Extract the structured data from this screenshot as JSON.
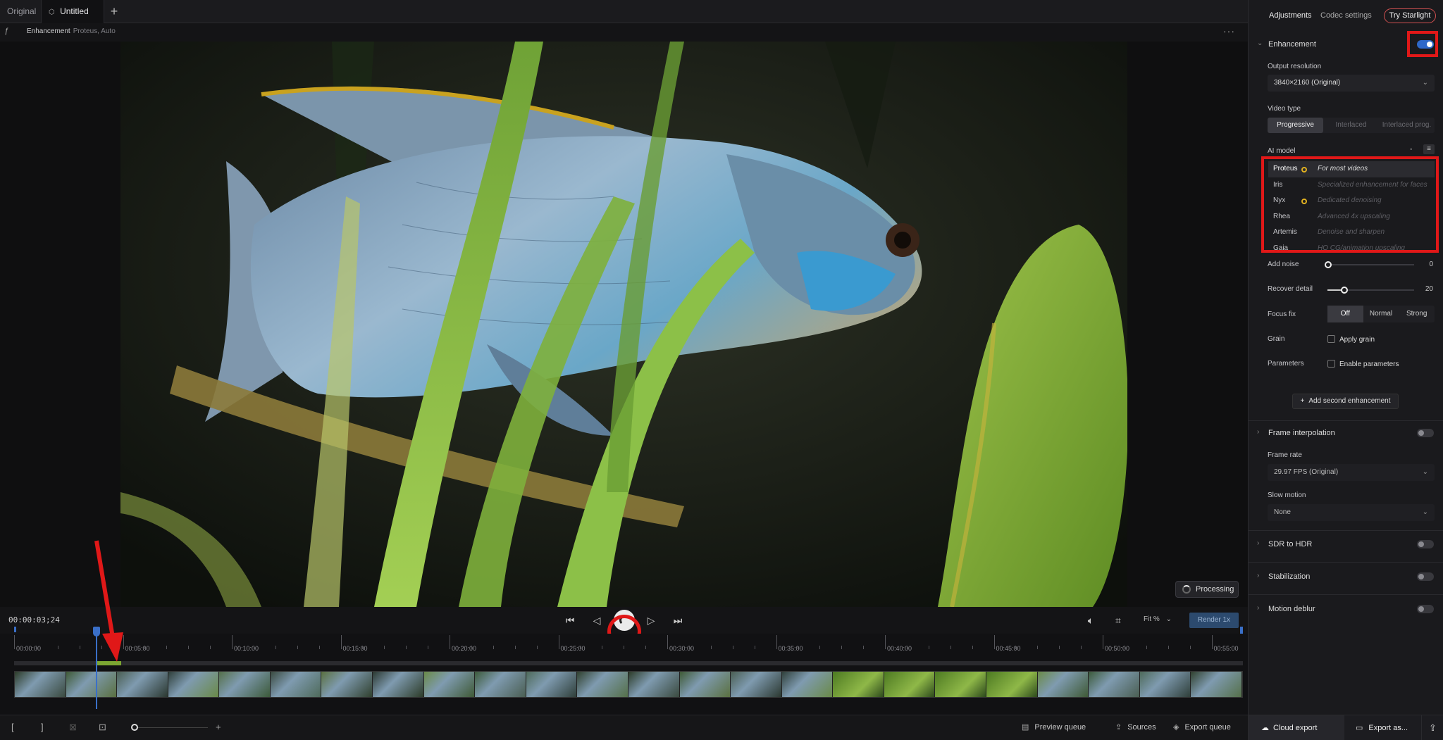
{
  "tabs": [
    {
      "label": "Original"
    },
    {
      "label": "Untitled"
    }
  ],
  "subbar": {
    "title": "Enhancement",
    "subtitle": "Proteus, Auto"
  },
  "viewer": {
    "processing_label": "Processing"
  },
  "transport": {
    "timecode": "00:00:03;24",
    "fit_label": "Fit %",
    "render_label": "Render 1x"
  },
  "timeline": {
    "ticks": [
      "00:00:00",
      "00:05:00",
      "00:10:00",
      "00:15:00",
      "00:20:00",
      "00:25:00",
      "00:30:00",
      "00:35:00",
      "00:40:00",
      "00:45:00",
      "00:50:00",
      "00:55:00"
    ]
  },
  "bottombar": {
    "preview_queue": "Preview queue",
    "sources": "Sources",
    "export_queue": "Export queue"
  },
  "panel": {
    "tabs": {
      "adjustments": "Adjustments",
      "codec": "Codec settings",
      "starlight": "Try Starlight"
    },
    "enhancement": {
      "title": "Enhancement",
      "output_resolution_label": "Output resolution",
      "output_resolution_value": "3840×2160 (Original)",
      "video_type_label": "Video type",
      "video_types": [
        "Progressive",
        "Interlaced",
        "Interlaced prog."
      ],
      "ai_model_label": "AI model",
      "models": [
        {
          "name": "Proteus",
          "desc": "For most videos"
        },
        {
          "name": "Iris",
          "desc": "Specialized enhancement for faces"
        },
        {
          "name": "Nyx",
          "desc": "Dedicated denoising"
        },
        {
          "name": "Rhea",
          "desc": "Advanced 4x upscaling"
        },
        {
          "name": "Artemis",
          "desc": "Denoise and sharpen"
        },
        {
          "name": "Gaia",
          "desc": "HQ CG/animation upscaling"
        }
      ],
      "add_noise_label": "Add noise",
      "add_noise_value": "0",
      "recover_detail_label": "Recover detail",
      "recover_detail_value": "20",
      "focus_fix_label": "Focus fix",
      "focus_fix_options": [
        "Off",
        "Normal",
        "Strong"
      ],
      "grain_label": "Grain",
      "apply_grain": "Apply grain",
      "parameters_label": "Parameters",
      "enable_parameters": "Enable parameters",
      "add_second": "Add second enhancement"
    },
    "frame_interpolation": {
      "title": "Frame interpolation",
      "frame_rate_label": "Frame rate",
      "frame_rate_value": "29.97 FPS (Original)",
      "slow_motion_label": "Slow motion",
      "slow_motion_value": "None"
    },
    "sdr_to_hdr": "SDR to HDR",
    "stabilization": "Stabilization",
    "motion_deblur": "Motion deblur",
    "cloud_export": "Cloud export",
    "export_as": "Export as..."
  }
}
